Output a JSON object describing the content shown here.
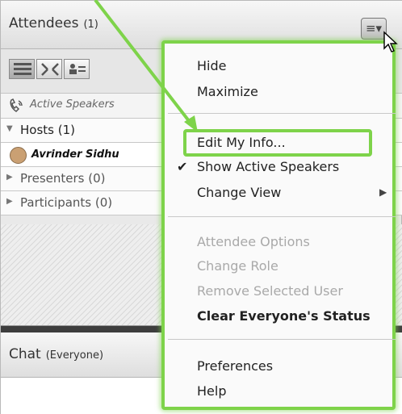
{
  "attendees_pod": {
    "title": "Attendees",
    "count": "(1)",
    "active_speakers_label": "Active Speakers",
    "groups": [
      {
        "label": "Hosts (1)",
        "expanded": true
      },
      {
        "label": "Presenters (0)",
        "expanded": false
      },
      {
        "label": "Participants (0)",
        "expanded": false
      }
    ],
    "host_user": "Avrinder Sidhu"
  },
  "chat_pod": {
    "title": "Chat",
    "scope": "(Everyone)"
  },
  "menu": {
    "items": [
      {
        "label": "Hide",
        "enabled": true
      },
      {
        "label": "Maximize",
        "enabled": true
      },
      {
        "label": "Edit My Info...",
        "enabled": true,
        "highlighted": true
      },
      {
        "label": "Show Active Speakers",
        "enabled": true,
        "checked": true
      },
      {
        "label": "Change View",
        "enabled": true,
        "submenu": true
      },
      {
        "label": "Attendee Options",
        "enabled": false
      },
      {
        "label": "Change Role",
        "enabled": false
      },
      {
        "label": "Remove Selected User",
        "enabled": false
      },
      {
        "label": "Clear Everyone's Status",
        "enabled": true,
        "bold": true
      },
      {
        "label": "Preferences",
        "enabled": true
      },
      {
        "label": "Help",
        "enabled": true
      }
    ]
  },
  "colors": {
    "highlight": "#7ed34a",
    "separator": "#3e3e3e"
  }
}
